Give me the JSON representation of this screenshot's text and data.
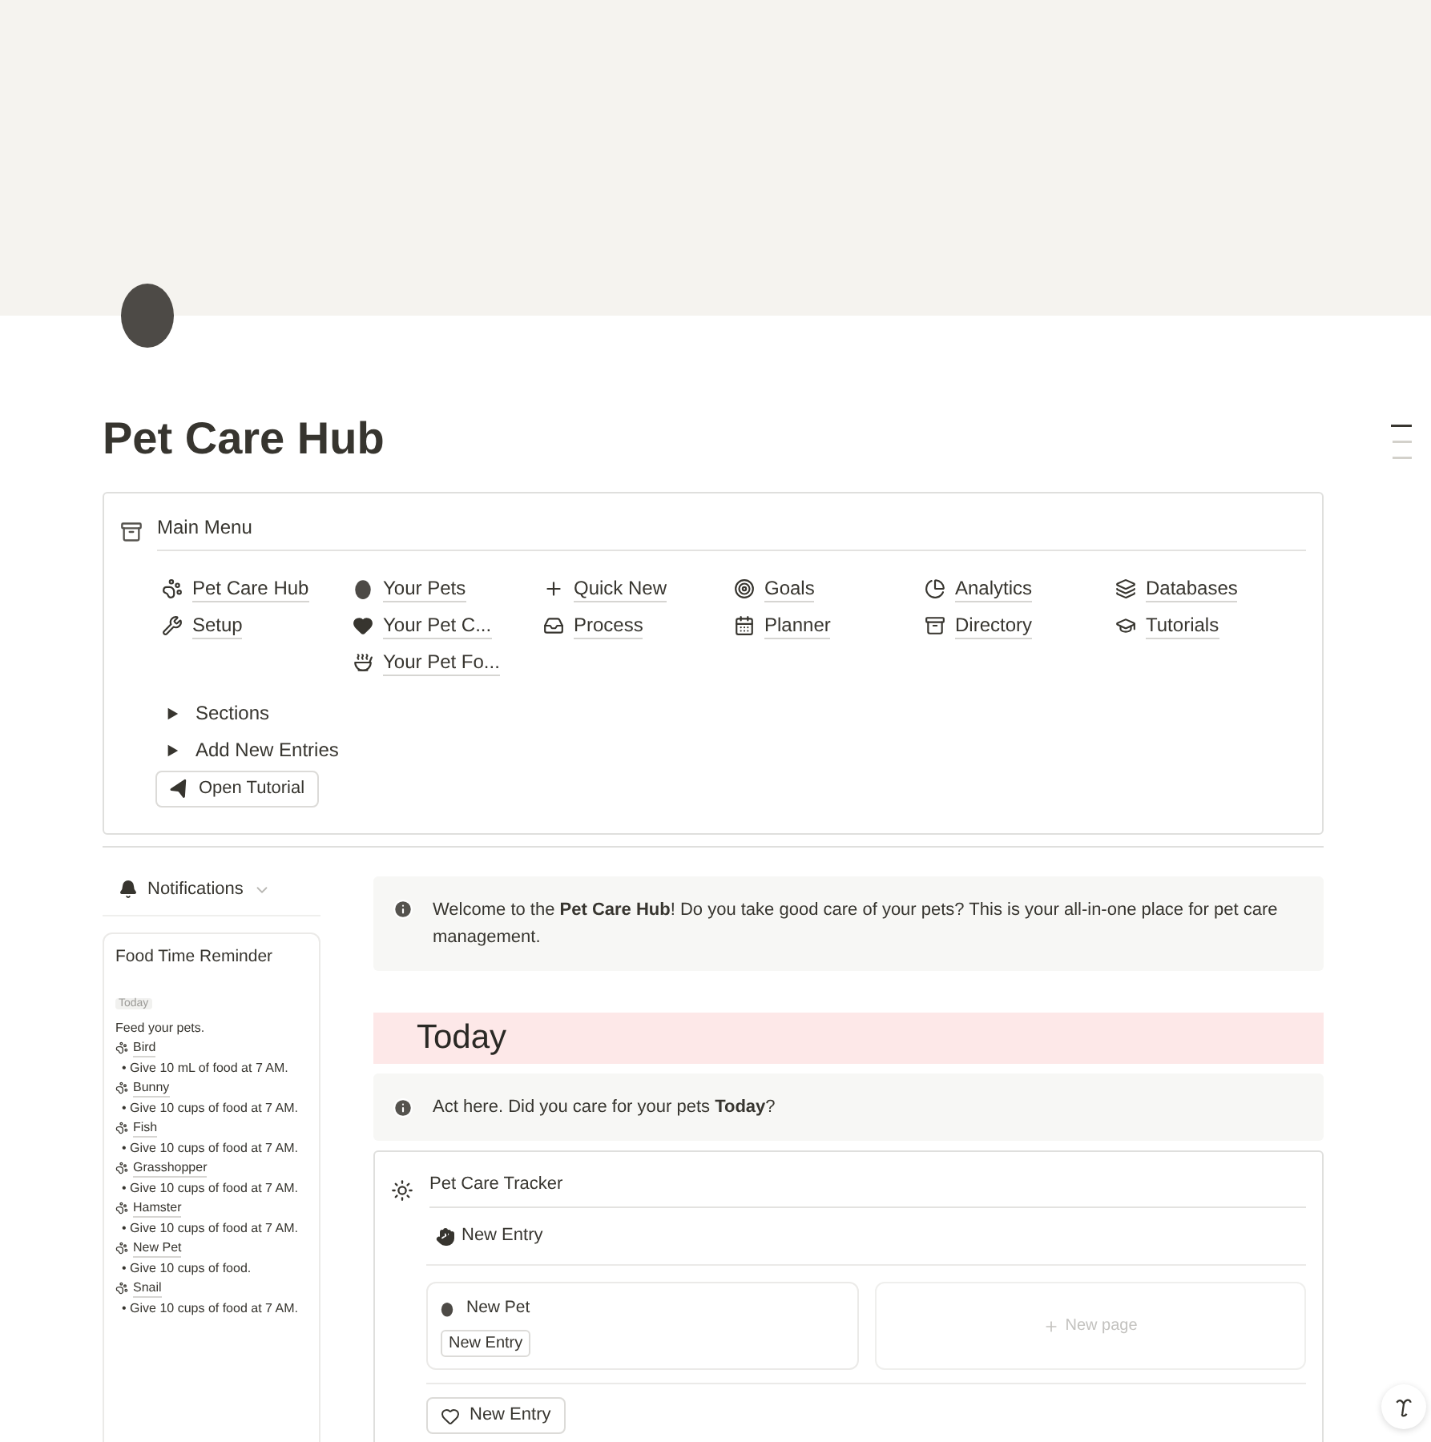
{
  "page": {
    "title": "Pet Care Hub"
  },
  "main_menu": {
    "title": "Main Menu",
    "columns": [
      [
        {
          "label": "Pet Care Hub"
        },
        {
          "label": "Setup"
        }
      ],
      [
        {
          "label": "Your Pets"
        },
        {
          "label": "Your Pet C..."
        },
        {
          "label": "Your Pet Fo..."
        }
      ],
      [
        {
          "label": "Quick New"
        },
        {
          "label": "Process"
        }
      ],
      [
        {
          "label": "Goals"
        },
        {
          "label": "Planner"
        }
      ],
      [
        {
          "label": "Analytics"
        },
        {
          "label": "Directory"
        }
      ],
      [
        {
          "label": "Databases"
        },
        {
          "label": "Tutorials"
        }
      ]
    ],
    "toggles": [
      {
        "label": "Sections",
        "expanded": false
      },
      {
        "label": "Add New Entries",
        "expanded": false
      }
    ],
    "button": "Open Tutorial"
  },
  "notifications": {
    "title": "Notifications",
    "card": {
      "title": "Food Time Reminder",
      "tag": "Today",
      "intro": "Feed your pets.",
      "pets": [
        {
          "name": "Bird",
          "note": "• Give 10 mL of food at 7 AM."
        },
        {
          "name": "Bunny",
          "note": "• Give 10 cups of food at 7 AM."
        },
        {
          "name": "Fish",
          "note": "• Give 10 cups of food at 7 AM."
        },
        {
          "name": "Grasshopper",
          "note": "• Give 10 cups of food at 7 AM."
        },
        {
          "name": "Hamster",
          "note": "• Give 10 cups of food at 7 AM."
        },
        {
          "name": "New Pet",
          "note": "• Give 10 cups of food."
        },
        {
          "name": "Snail",
          "note": "• Give 10 cups of food at 7 AM."
        }
      ]
    }
  },
  "welcome_callout": "Welcome to the **Pet Care Hub**! Do you take good care of your pets? This is your all-in-one place for pet care management.",
  "today": {
    "heading": "Today",
    "callout": "Act here. Did you care for your pets **Today**?"
  },
  "tracker": {
    "title": "Pet Care Tracker",
    "new_entry_button": "New Entry",
    "cards": [
      {
        "kind": "entry",
        "title": "New Pet",
        "tag": "New Entry"
      },
      {
        "kind": "add",
        "label": "New page"
      }
    ],
    "bottom_button": "New Entry"
  }
}
